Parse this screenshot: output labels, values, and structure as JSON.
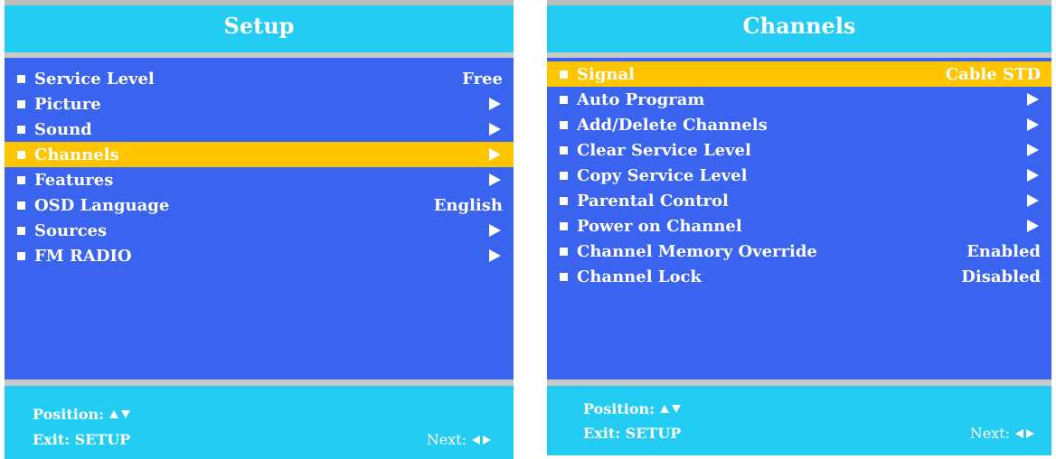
{
  "setup": {
    "title": "Setup",
    "items": [
      {
        "label": "Service Level",
        "value": "Free",
        "arrow": false,
        "selected": false
      },
      {
        "label": "Picture",
        "value": "",
        "arrow": true,
        "selected": false
      },
      {
        "label": "Sound",
        "value": "",
        "arrow": true,
        "selected": false
      },
      {
        "label": "Channels",
        "value": "",
        "arrow": true,
        "selected": true
      },
      {
        "label": "Features",
        "value": "",
        "arrow": true,
        "selected": false
      },
      {
        "label": "OSD Language",
        "value": "English",
        "arrow": false,
        "selected": false
      },
      {
        "label": "Sources",
        "value": "",
        "arrow": true,
        "selected": false
      },
      {
        "label": "FM RADIO",
        "value": "",
        "arrow": true,
        "selected": false
      }
    ],
    "footer": {
      "position_label": "Position:",
      "exit_label": "Exit: SETUP",
      "next_label": "Next:"
    }
  },
  "channels": {
    "title": "Channels",
    "items": [
      {
        "label": "Signal",
        "value": "Cable STD",
        "arrow": false,
        "selected": true
      },
      {
        "label": "Auto Program",
        "value": "",
        "arrow": true,
        "selected": false
      },
      {
        "label": "Add/Delete Channels",
        "value": "",
        "arrow": true,
        "selected": false
      },
      {
        "label": "Clear Service Level",
        "value": "",
        "arrow": true,
        "selected": false
      },
      {
        "label": "Copy Service Level",
        "value": "",
        "arrow": true,
        "selected": false
      },
      {
        "label": "Parental Control",
        "value": "",
        "arrow": true,
        "selected": false
      },
      {
        "label": "Power on Channel",
        "value": "",
        "arrow": true,
        "selected": false
      },
      {
        "label": "Channel Memory Override",
        "value": "Enabled",
        "arrow": false,
        "selected": false
      },
      {
        "label": "Channel Lock",
        "value": "Disabled",
        "arrow": false,
        "selected": false
      }
    ],
    "footer": {
      "position_label": "Position:",
      "exit_label": "Exit: SETUP",
      "next_label": "Next:"
    }
  },
  "colors": {
    "title_bar": "#22ccf2",
    "menu_bg": "#3a64ef",
    "highlight": "#ffc400",
    "separator": "#c8c8c8"
  },
  "icons": {
    "bullet": "square-bullet-icon",
    "submenu": "arrow-right-icon"
  }
}
